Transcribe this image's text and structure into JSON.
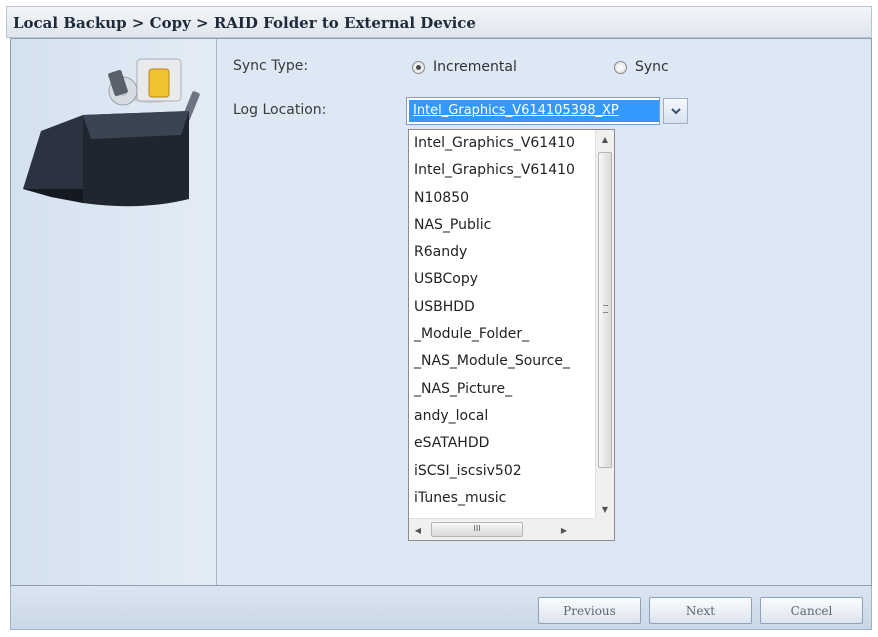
{
  "breadcrumb": "Local Backup > Copy > RAID Folder to External Device",
  "form": {
    "sync_type_label": "Sync Type:",
    "sync_options": [
      {
        "label": "Incremental",
        "selected": true
      },
      {
        "label": "Sync",
        "selected": false
      }
    ],
    "log_location_label": "Log Location:",
    "log_location_value": "Intel_Graphics_V614105398_XP"
  },
  "dropdown": {
    "items": [
      "Intel_Graphics_V61410",
      "Intel_Graphics_V61410",
      "N10850",
      "NAS_Public",
      "R6andy",
      "USBCopy",
      "USBHDD",
      "_Module_Folder_",
      "_NAS_Module_Source_",
      "_NAS_Picture_",
      "andy_local",
      "eSATAHDD",
      "iSCSI_iscsiv502",
      "iTunes_music"
    ],
    "scroll_up": "▲",
    "scroll_down": "▼",
    "scroll_left": "◀",
    "scroll_right": "▶",
    "h_thumb_grip": "III"
  },
  "footer": {
    "previous_label": "Previous",
    "next_label": "Next",
    "cancel_label": "Cancel"
  },
  "icons": {
    "select_arrow": "chevron-down-icon",
    "illustration": "backup-box-illustration"
  },
  "colors": {
    "selection": "#3399ff",
    "panel_bg": "#dde8f4"
  }
}
